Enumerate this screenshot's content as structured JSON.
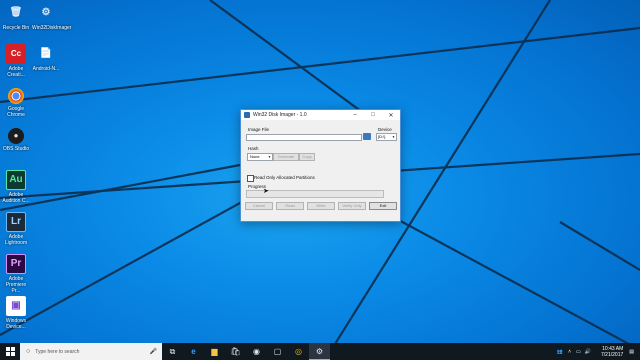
{
  "desktop_icons": [
    {
      "label": "Recycle Bin",
      "glyph": "🗑",
      "color": "transparent",
      "icon": "recycle-bin-icon"
    },
    {
      "label": "Win32DiskImager",
      "glyph": "⚙",
      "color": "transparent",
      "icon": "disk-imager-icon"
    },
    {
      "label": "Adobe Creati...",
      "glyph": "Cc",
      "color": "#d81f26",
      "icon": "adobe-cc-icon"
    },
    {
      "label": "Android-N...",
      "glyph": "📄",
      "color": "transparent",
      "icon": "file-icon"
    },
    {
      "label": "Google Chrome",
      "glyph": "◉",
      "color": "transparent",
      "icon": "chrome-icon"
    },
    {
      "label": "OBS Studio",
      "glyph": "●",
      "color": "#1c1c1c",
      "icon": "obs-icon"
    },
    {
      "label": "Adobe Audition C...",
      "glyph": "Au",
      "color": "#0c3b2e",
      "icon": "audition-icon"
    },
    {
      "label": "Adobe Lightroom",
      "glyph": "Lr",
      "color": "#1b2b3a",
      "icon": "lightroom-icon"
    },
    {
      "label": "Adobe Premiere Pr...",
      "glyph": "Pr",
      "color": "#2a0a3f",
      "icon": "premiere-icon"
    },
    {
      "label": "Windows Device...",
      "glyph": "▣",
      "color": "#ffffff",
      "icon": "windows-device-icon"
    }
  ],
  "window": {
    "title": "Win32 Disk Imager - 1.0",
    "image_file_label": "Image File",
    "image_file_value": "",
    "device_label": "Device",
    "device_value": "[D:\\]",
    "hash_label": "Hash",
    "hash_value": "None",
    "generate_label": "Generate",
    "copy_label": "Copy",
    "read_only_label": "Read Only Allocated Partitions",
    "read_only_checked": false,
    "progress_label": "Progress",
    "progress": 0,
    "buttons": {
      "cancel": "Cancel",
      "read": "Read",
      "write": "Write",
      "verify": "Verify Only",
      "exit": "Exit"
    }
  },
  "taskbar": {
    "search_placeholder": "Type here to search",
    "apps": [
      "task-view-icon",
      "edge-icon",
      "file-explorer-icon",
      "store-icon",
      "obs-icon",
      "photos-icon",
      "chrome-icon",
      "disk-imager-icon"
    ],
    "time": "10:43 AM",
    "date": "7/21/2017"
  }
}
